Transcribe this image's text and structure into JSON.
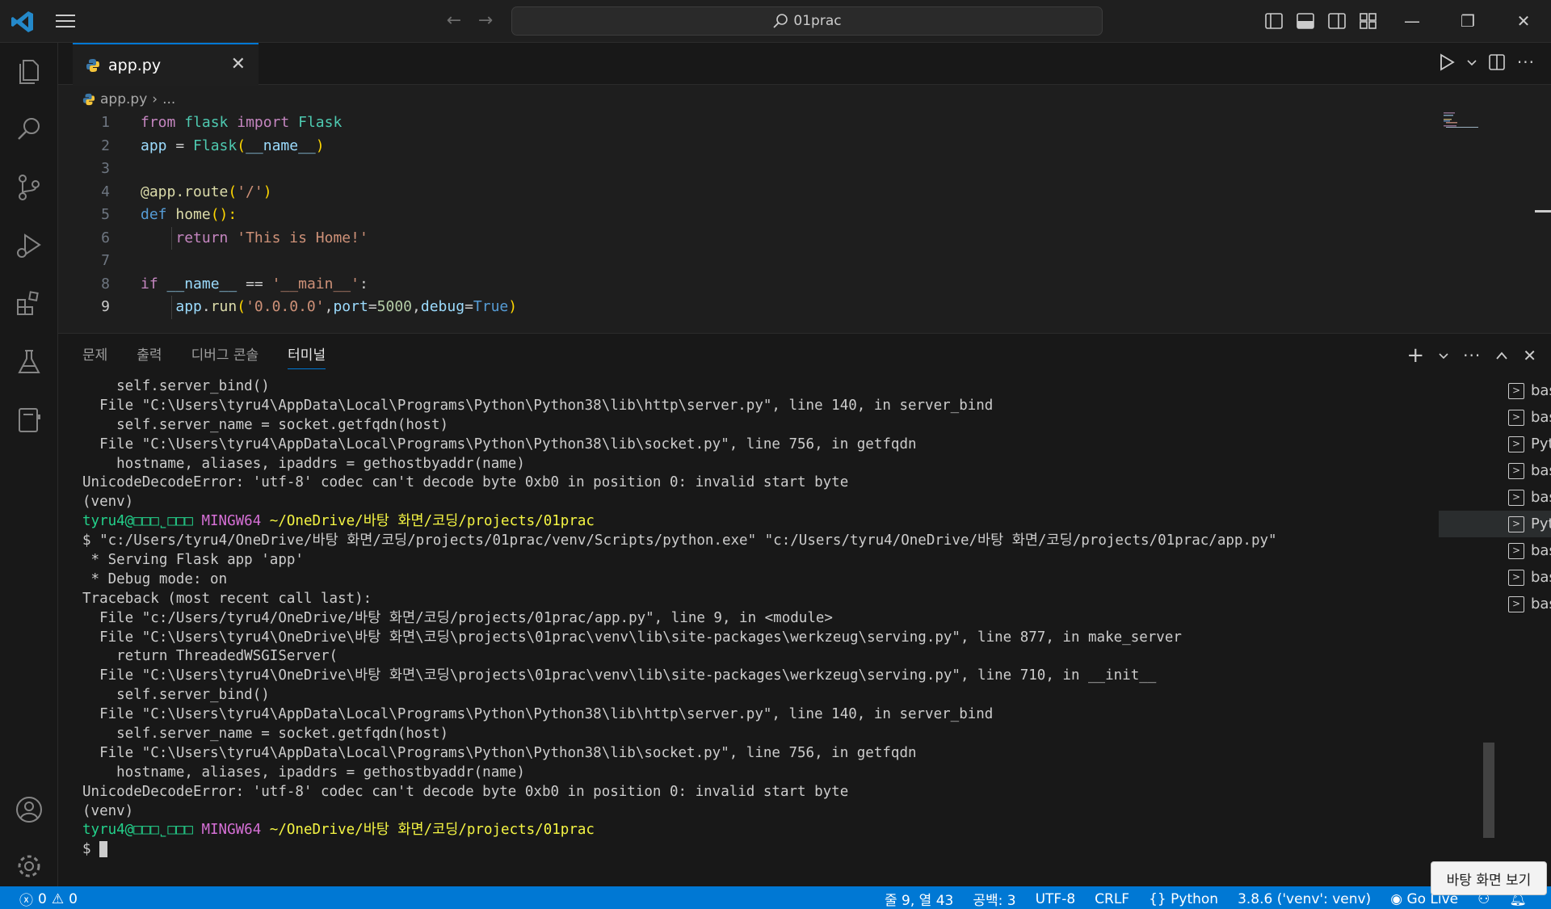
{
  "titlebar": {
    "search_text": "01prac"
  },
  "tab": {
    "filename": "app.py"
  },
  "breadcrumb": {
    "file": "app.py",
    "rest": "..."
  },
  "code_lines": [
    {
      "n": "1"
    },
    {
      "n": "2"
    },
    {
      "n": "3"
    },
    {
      "n": "4"
    },
    {
      "n": "5"
    },
    {
      "n": "6"
    },
    {
      "n": "7"
    },
    {
      "n": "8"
    },
    {
      "n": "9"
    }
  ],
  "code": {
    "l1": {
      "a": "from",
      "b": "flask",
      "c": "import",
      "d": "Flask"
    },
    "l2": {
      "a": "app",
      "b": " = ",
      "c": "Flask",
      "d": "(",
      "e": "__name__",
      "f": ")"
    },
    "l4": {
      "a": "@app.route",
      "b": "(",
      "c": "'/'",
      "d": ")"
    },
    "l5": {
      "a": "def",
      "b": "home",
      "c": "():"
    },
    "l6": {
      "a": "return",
      "b": "'This is Home!'"
    },
    "l8": {
      "a": "if",
      "b": "__name__",
      "c": " == ",
      "d": "'__main__'",
      "e": ":"
    },
    "l9": {
      "a": "app",
      "b": ".",
      "c": "run",
      "d": "(",
      "e": "'0.0.0.0'",
      "f": ",",
      "g": "port",
      "h": "=",
      "i": "5000",
      "j": ",",
      "k": "debug",
      "l": "=",
      "m": "True",
      "n": ")"
    }
  },
  "panel": {
    "tabs": [
      "문제",
      "출력",
      "디버그 콘솔",
      "터미널"
    ],
    "active_tab": "터미널"
  },
  "terminal": {
    "lines": [
      "    self.server_bind()",
      "  File \"C:\\Users\\tyru4\\AppData\\Local\\Programs\\Python\\Python38\\lib\\http\\server.py\", line 140, in server_bind",
      "    self.server_name = socket.getfqdn(host)",
      "  File \"C:\\Users\\tyru4\\AppData\\Local\\Programs\\Python\\Python38\\lib\\socket.py\", line 756, in getfqdn",
      "    hostname, aliases, ipaddrs = gethostbyaddr(name)",
      "UnicodeDecodeError: 'utf-8' codec can't decode byte 0xb0 in position 0: invalid start byte",
      "(venv)"
    ],
    "prompt1_user": "tyru4@□□□˾□□□",
    "prompt_host": "MINGW64",
    "prompt_path": "~/OneDrive/바탕 화면/코딩/projects/01prac",
    "lines2": [
      "$ \"c:/Users/tyru4/OneDrive/바탕 화면/코딩/projects/01prac/venv/Scripts/python.exe\" \"c:/Users/tyru4/OneDrive/바탕 화면/코딩/projects/01prac/app.py\"",
      " * Serving Flask app 'app'",
      " * Debug mode: on",
      "Traceback (most recent call last):",
      "  File \"c:/Users/tyru4/OneDrive/바탕 화면/코딩/projects/01prac/app.py\", line 9, in <module>",
      "  File \"C:\\Users\\tyru4\\OneDrive\\바탕 화면\\코딩\\projects\\01prac\\venv\\lib\\site-packages\\werkzeug\\serving.py\", line 877, in make_server",
      "    return ThreadedWSGIServer(",
      "  File \"C:\\Users\\tyru4\\OneDrive\\바탕 화면\\코딩\\projects\\01prac\\venv\\lib\\site-packages\\werkzeug\\serving.py\", line 710, in __init__",
      "    self.server_bind()",
      "  File \"C:\\Users\\tyru4\\AppData\\Local\\Programs\\Python\\Python38\\lib\\http\\server.py\", line 140, in server_bind",
      "    self.server_name = socket.getfqdn(host)",
      "  File \"C:\\Users\\tyru4\\AppData\\Local\\Programs\\Python\\Python38\\lib\\socket.py\", line 756, in getfqdn",
      "    hostname, aliases, ipaddrs = gethostbyaddr(name)",
      "UnicodeDecodeError: 'utf-8' codec can't decode byte 0xb0 in position 0: invalid start byte",
      "(venv)"
    ],
    "final_prompt": "$ "
  },
  "terminal_list": [
    {
      "label": "bash"
    },
    {
      "label": "bash"
    },
    {
      "label": "Python"
    },
    {
      "label": "bash"
    },
    {
      "label": "bash"
    },
    {
      "label": "Python",
      "selected": true
    },
    {
      "label": "bash"
    },
    {
      "label": "bash"
    },
    {
      "label": "bash"
    }
  ],
  "statusbar": {
    "errors": "0",
    "warnings": "0",
    "position": "줄 9, 열 43",
    "spaces": "공백: 3",
    "encoding": "UTF-8",
    "eol": "CRLF",
    "language": "Python",
    "interpreter": "3.8.6 ('venv': venv)",
    "golive": "Go Live"
  },
  "tooltip": "바탕 화면 보기",
  "colors": {
    "accent": "#0078d4",
    "statusbar": "#0078d4",
    "editor_bg": "#1e1e1e"
  }
}
